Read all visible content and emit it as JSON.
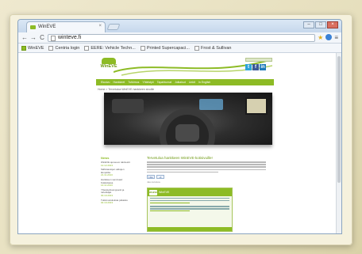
{
  "browser": {
    "tab_title": "WinEVE",
    "tab_close": "×",
    "url": "winteve.fi",
    "back": "←",
    "forward": "→",
    "reload": "C",
    "menu": "≡",
    "window_controls": [
      "–",
      "□",
      "×"
    ]
  },
  "bookmarks": [
    {
      "label": "WinEVE",
      "icon": "winteve-favicon"
    },
    {
      "label": "Centria login",
      "icon": "page-icon"
    },
    {
      "label": "EERE: Vehicle Techn...",
      "icon": "page-icon"
    },
    {
      "label": "Printed Supercapaci...",
      "icon": "page-icon"
    },
    {
      "label": "Frost & Sullivan",
      "icon": "page-icon"
    }
  ],
  "site": {
    "logo_text": "WinEVE",
    "social": [
      "t",
      "f",
      "in"
    ],
    "nav": [
      "Etusivu",
      "Hankkeet",
      "Tutkimus",
      "Yhteistyö",
      "Tapahtumat",
      "Julkaisut",
      "Linkit",
      "In English"
    ],
    "breadcrumb": "Home > Tervetuloa WinEVE-hankkeen sivuille",
    "sidebar_title": "News",
    "sidebar_items": [
      {
        "text": "WinEVE ajoneuvo talvitestit",
        "date": "12.12.2013"
      },
      {
        "text": "Sähköautojen akkujen lämpötila",
        "date": "21.11.2013"
      },
      {
        "text": "Hankkeen seminaari Kokkolassa",
        "date": "14.11.2013"
      },
      {
        "text": "Yhteistyökumppanit ja rahoittajat",
        "date": "30.10.2013"
      },
      {
        "text": "Tutkimustuloksia julkaistu",
        "date": "02.10.2013"
      }
    ],
    "article_title": "Tervetuloa hankkeen WinEVE-kotisivuille!",
    "share_labels": [
      "Like",
      "+1"
    ],
    "share_caption": "Jaa sivustoa",
    "feed_logo": "WinEVE",
    "feed_title": "WinEVE"
  },
  "colors": {
    "brand_green": "#8dbb25",
    "brand_green_dark": "#6f9a13"
  }
}
